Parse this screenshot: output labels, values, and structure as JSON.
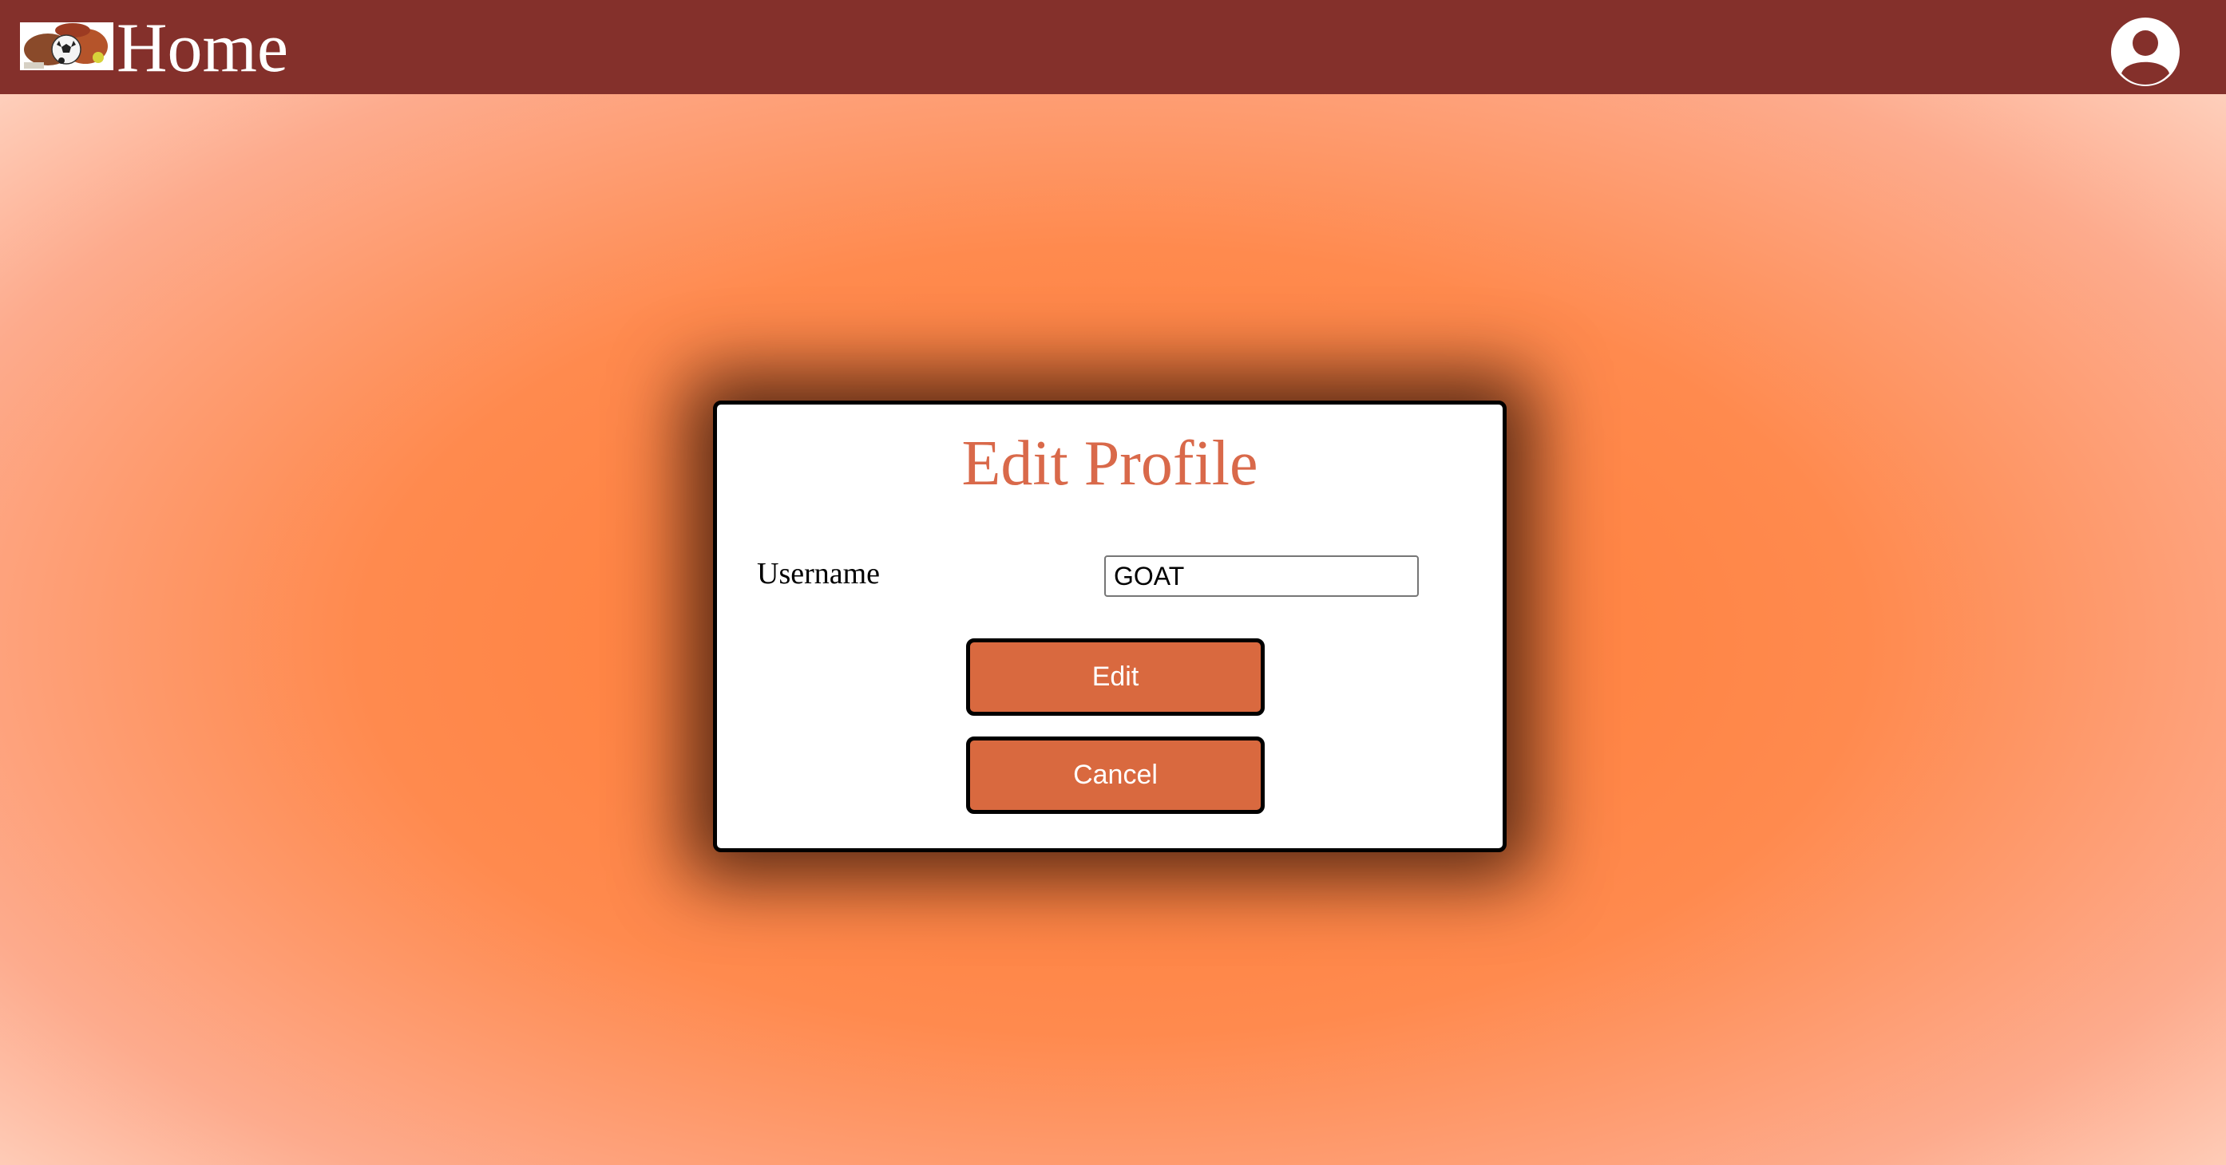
{
  "header": {
    "title": "Home",
    "logo_icon": "soccer-ball-logo-icon",
    "account_icon": "user-account-icon",
    "background_color": "#84302b"
  },
  "modal": {
    "title": "Edit Profile",
    "username_label": "Username",
    "username_value": "GOAT",
    "edit_button": "Edit",
    "cancel_button": "Cancel",
    "accent_color": "#d9693f"
  }
}
